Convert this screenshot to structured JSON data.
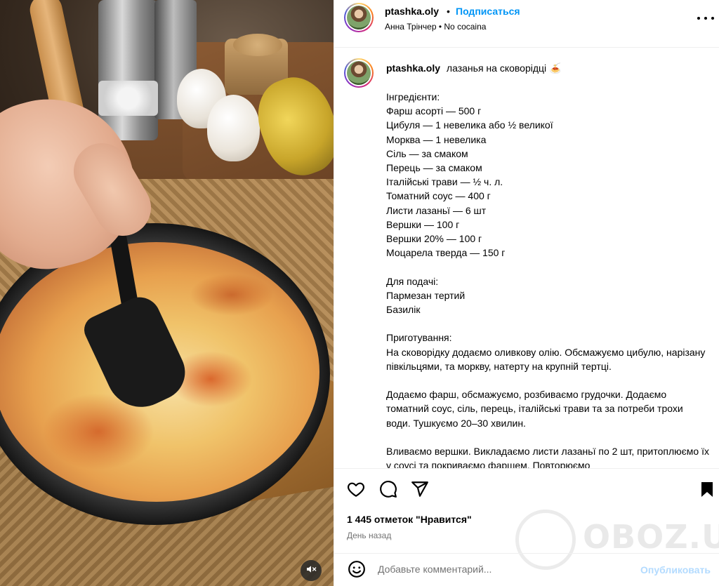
{
  "post": {
    "username": "ptashka.oly",
    "follow_label": "Подписаться",
    "separator": "•",
    "author_name": "Анна Трінчер",
    "audio": "No cocaina",
    "caption_title": "лазанья на сковорідці 🍝",
    "caption_body": "Інгредієнти:\nФарш асорті — 500 г\nЦибуля — 1 невелика або ½ великої\nМорква — 1 невелика\nСіль — за смаком\nПерець — за смаком\nІталійські трави — ½ ч. л.\nТоматний соус — 400 г\nЛисти лазаньї — 6 шт\nВершки — 100 г\nВершки 20% — 100 г\nМоцарела тверда — 150 г\n\nДля подачі:\nПармезан тертий\nБазилік\n\nПриготування:\nНа сковорідку додаємо оливкову олію. Обсмажуємо цибулю, нарізану півкільцями, та моркву, натерту на крупній тертці.\n\nДодаємо фарш, обсмажуємо, розбиваємо грудочки. Додаємо томатний соус, сіль, перець, італійські трави та за потреби трохи води. Тушкуємо 20–30 хвилин.\n\nВливаємо вершки. Викладаємо листи лазаньї по 2 шт, притоплюємо їх у соусі та покриваємо фаршем. Повторюємо",
    "likes_text": "1 445 отметок \"Нравится\"",
    "time_text": "День назад"
  },
  "comment": {
    "placeholder": "Добавьте комментарий...",
    "publish_label": "Опубликовать"
  },
  "icons": {
    "more": "more-horizontal-icon",
    "like": "heart-icon",
    "comment": "comment-bubble-icon",
    "share": "paper-plane-icon",
    "save": "bookmark-icon",
    "emoji": "smiley-icon",
    "mute": "speaker-muted-icon"
  },
  "colors": {
    "link": "#0095f6",
    "publish_disabled": "#b3dbff",
    "secondary_text": "#737373",
    "divider": "#efefef"
  },
  "watermark": {
    "text": "OBOZ.UA"
  }
}
